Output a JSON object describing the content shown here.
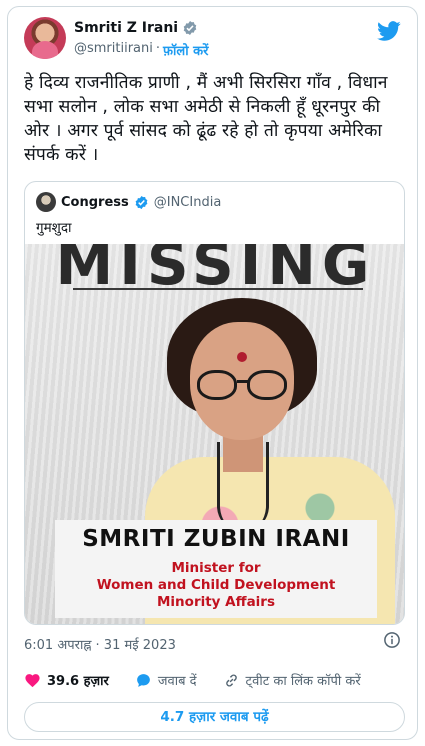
{
  "tweet": {
    "author_name": "Smriti Z Irani",
    "handle": "@smritiirani",
    "separator": "·",
    "follow_label": "फ़ॉलो करें",
    "text": "हे दिव्य राजनीतिक प्राणी , मैं अभी सिरसिरा गाँव , विधान सभा सलोन , लोक सभा अमेठी से निकली हूँ धूरनपुर की ओर । अगर पूर्व सांसद को ढूंढ रहे हो तो कृपया अमेरिका संपर्क करें ।",
    "timestamp": "6:01 अपराह्न · 31 मई 2023",
    "like_count": "39.6 हज़ार",
    "reply_label": "जवाब दें",
    "copy_link_label": "ट्वीट का लिंक कॉपी करें",
    "read_replies_label": "4.7 हज़ार जवाब पढ़ें"
  },
  "quoted": {
    "author_name": "Congress",
    "handle": "@INCIndia",
    "text": "गुमशुदा",
    "poster": {
      "headline": "MISSING",
      "name": "SMRITI ZUBIN IRANI",
      "role_lines": [
        "Minister for",
        "Women and Child Development",
        "Minority Affairs"
      ]
    }
  },
  "colors": {
    "accent": "#1d9bf0",
    "like": "#f91880",
    "poster_red": "#c1121f",
    "text_secondary": "#536471"
  },
  "icons": [
    "verified-icon",
    "twitter-bird-icon",
    "info-icon",
    "heart-icon",
    "reply-icon",
    "link-icon"
  ]
}
